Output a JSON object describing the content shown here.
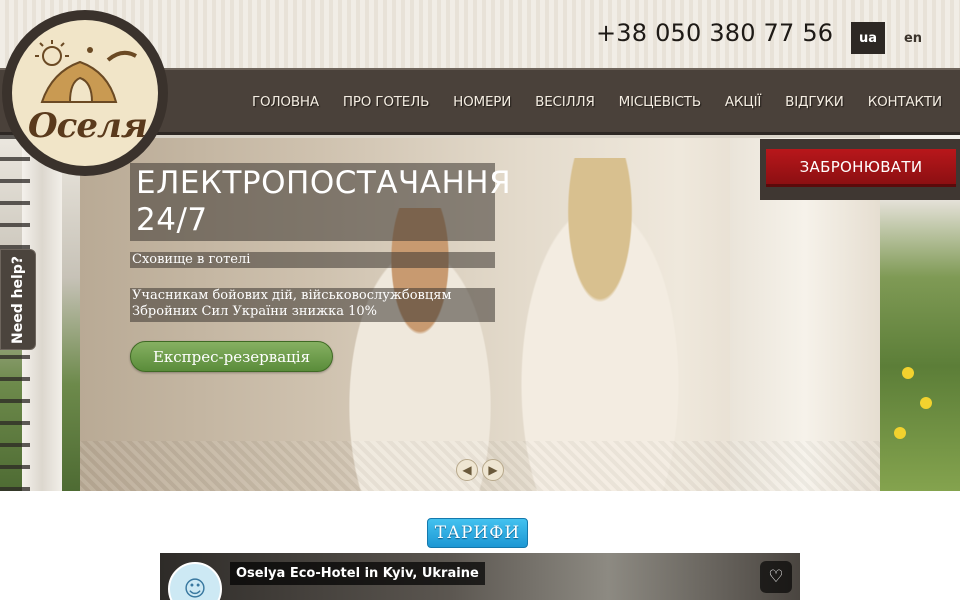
{
  "header": {
    "phone": "+38 050 380 77 56",
    "languages": [
      "ua",
      "en"
    ],
    "active_language": "ua",
    "logo_text": "Оселя"
  },
  "nav": {
    "items": [
      "ГОЛОВНА",
      "ПРО ГОТЕЛЬ",
      "НОМЕРИ",
      "ВЕСІЛЛЯ",
      "МІСЦЕВІСТЬ",
      "АКЦІЇ",
      "ВІДГУКИ",
      "КОНТАКТИ"
    ]
  },
  "hero": {
    "title_line1": "ЕЛЕКТРОПОСТАЧАННЯ",
    "title_line2": "24/7",
    "subtitle": "Сховище в готелі",
    "promo_line1": "Учасникам бойових дій, військовослужбовцям",
    "promo_line2": "Збройних Сил України знижка 10%",
    "express_button": "Експрес-резервація",
    "prev_icon": "arrow-left-icon",
    "next_icon": "arrow-right-icon"
  },
  "booking": {
    "button": "ЗАБРОНЮВАТИ"
  },
  "help": {
    "label": "Need help?"
  },
  "tariffs": {
    "label": "ТАРИФИ"
  },
  "video": {
    "title": "Oselya Eco-Hotel in Kyiv, Ukraine",
    "icon": "heart-icon"
  },
  "colors": {
    "nav_bg": "#4a413a",
    "book_red": "#a5141a",
    "express_green": "#6b9e48",
    "tariffs_blue": "#2aa9e2"
  }
}
